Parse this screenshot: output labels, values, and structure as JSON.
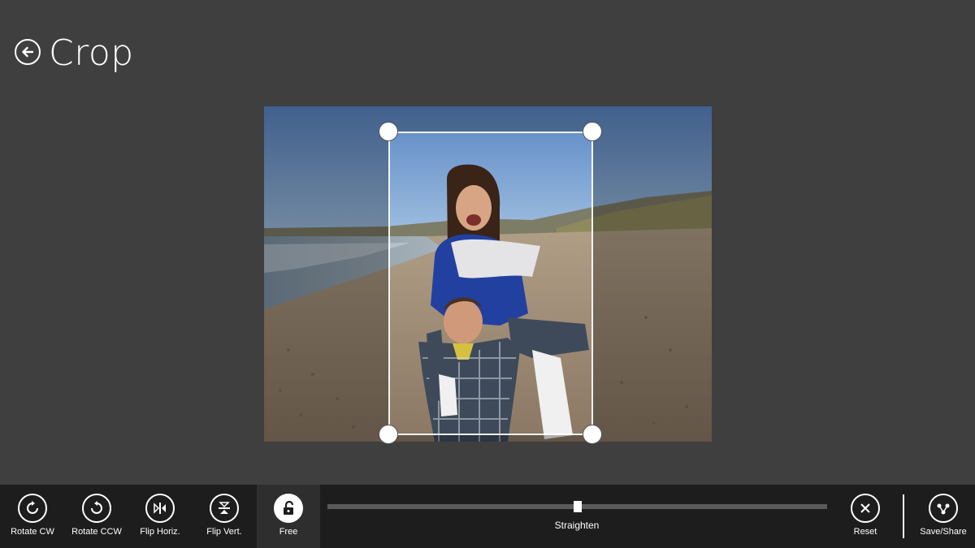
{
  "header": {
    "title": "Crop",
    "back_icon": "back-arrow-icon"
  },
  "photo": {
    "description_icon": "photo-canvas"
  },
  "appbar": {
    "commands": [
      {
        "id": "rotate-cw",
        "label": "Rotate CW",
        "icon": "rotate-cw-icon",
        "active": false
      },
      {
        "id": "rotate-ccw",
        "label": "Rotate CCW",
        "icon": "rotate-ccw-icon",
        "active": false
      },
      {
        "id": "flip-horiz",
        "label": "Flip Horiz.",
        "icon": "flip-horizontal-icon",
        "active": false
      },
      {
        "id": "flip-vert",
        "label": "Flip Vert.",
        "icon": "flip-vertical-icon",
        "active": false
      },
      {
        "id": "free",
        "label": "Free",
        "icon": "unlock-icon",
        "active": true
      }
    ],
    "straighten": {
      "label": "Straighten",
      "value": 0.5
    },
    "reset": {
      "label": "Reset",
      "icon": "close-icon"
    },
    "save_share": {
      "label": "Save/Share",
      "icon": "share-icon"
    }
  },
  "colors": {
    "background": "#3f3f3f",
    "appbar": "#1d1d1d",
    "active_command": "#2e2e2e",
    "foreground": "#ffffff"
  }
}
